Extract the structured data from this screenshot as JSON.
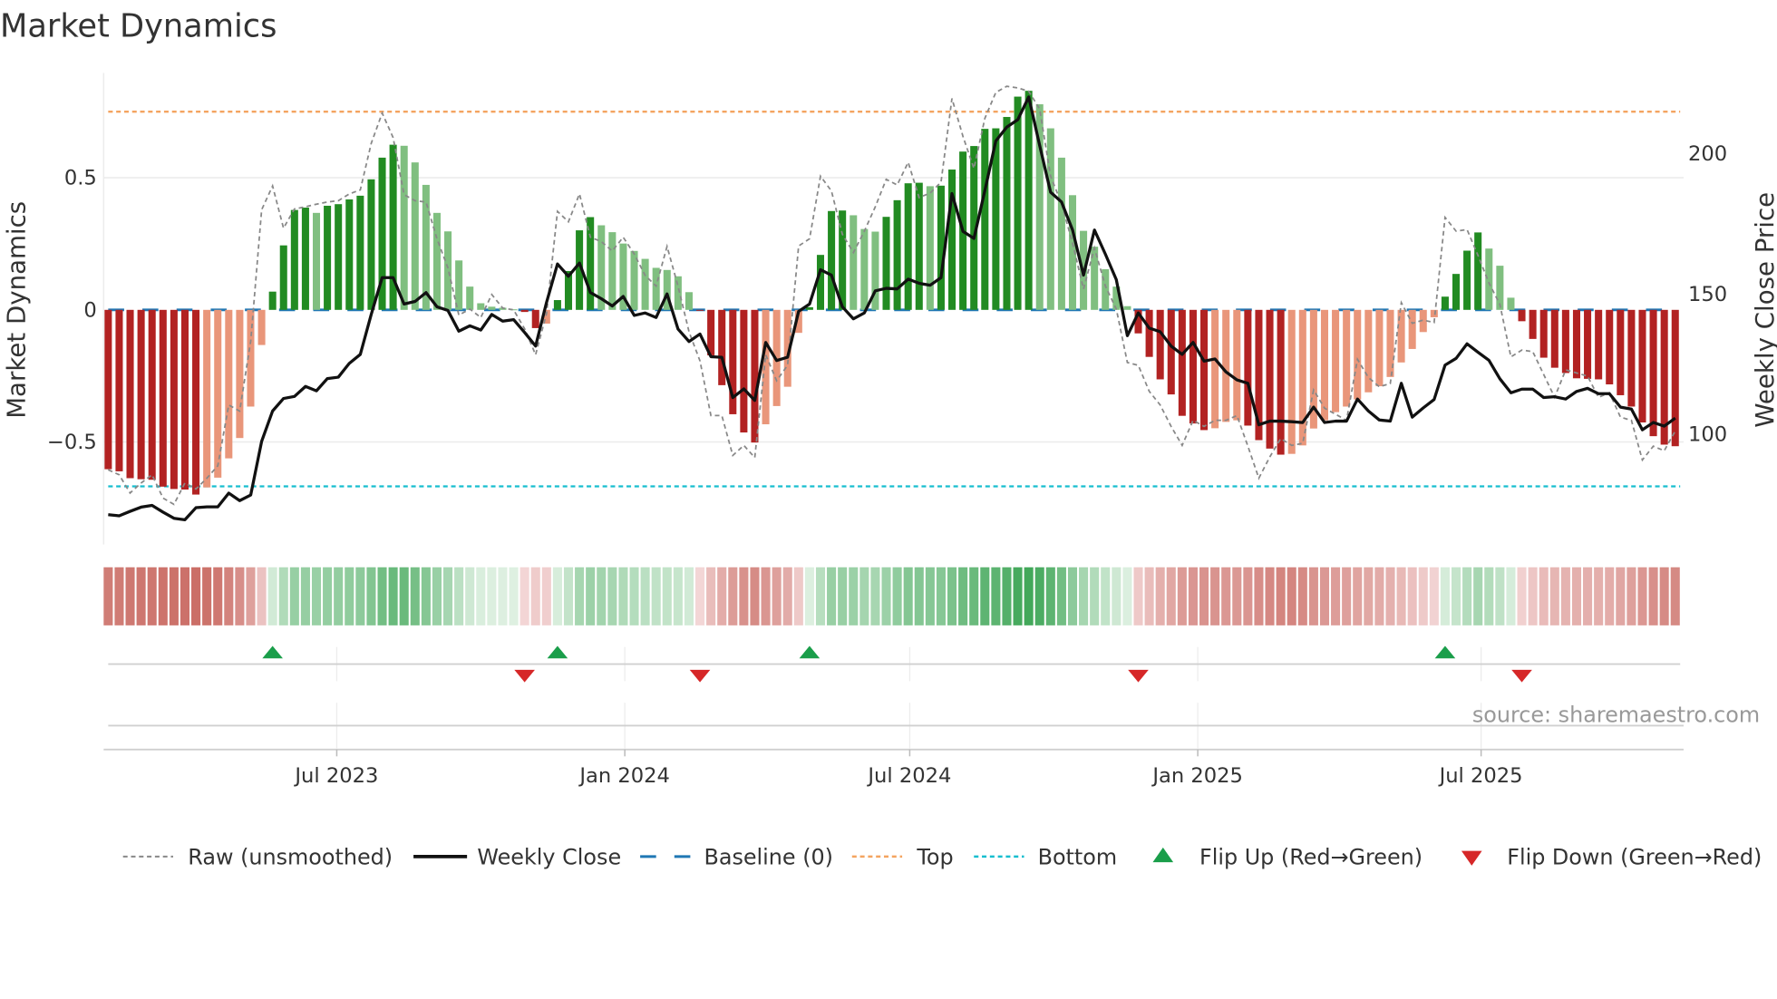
{
  "chart_data": {
    "type": "bar",
    "title": "Market Dynamics",
    "ylabel": "Market Dynamics",
    "ylabel_right": "Weekly Close Price",
    "ylim": [
      -0.8,
      0.85
    ],
    "ylim_right": [
      65,
      228
    ],
    "yticks": [
      {
        "value": 0.5,
        "label": "0.5"
      },
      {
        "value": 0,
        "label": "0"
      },
      {
        "value": -0.5,
        "label": "−0.5"
      }
    ],
    "yticks_right": [
      {
        "value": 200,
        "label": "200"
      },
      {
        "value": 150,
        "label": "150"
      },
      {
        "value": 100,
        "label": "100"
      }
    ],
    "xticks": [
      {
        "date": "2023-07-01",
        "label": "Jul 2023"
      },
      {
        "date": "2024-01-01",
        "label": "Jan 2024"
      },
      {
        "date": "2024-07-01",
        "label": "Jul 2024"
      },
      {
        "date": "2025-01-01",
        "label": "Jan 2025"
      },
      {
        "date": "2025-07-01",
        "label": "Jul 2025"
      }
    ],
    "start_date": "2023-02-05",
    "frequency": "weekly",
    "top_level": 0.75,
    "bottom_level": -0.668,
    "baseline": 0,
    "colors": {
      "up_strong": "#228b22",
      "up_weak": "#80bf80",
      "down_strong": "#b22222",
      "down_weak": "#e9967a",
      "close": "#111111",
      "raw": "#888888",
      "baseline": "#1f77b4",
      "top": "#f4a460",
      "bottom": "#17becf",
      "flip_up": "#1a9e4a",
      "flip_down": "#d62728"
    },
    "series": [
      {
        "name": "Market Dynamics",
        "values": [
          -0.603,
          -0.611,
          -0.637,
          -0.641,
          -0.643,
          -0.669,
          -0.678,
          -0.68,
          -0.699,
          -0.672,
          -0.635,
          -0.562,
          -0.485,
          -0.366,
          -0.133,
          0.069,
          0.244,
          0.378,
          0.387,
          0.367,
          0.394,
          0.4,
          0.418,
          0.432,
          0.494,
          0.576,
          0.625,
          0.621,
          0.558,
          0.473,
          0.367,
          0.297,
          0.187,
          0.088,
          0.025,
          0.012,
          0.008,
          0.002,
          -0.008,
          -0.069,
          -0.052,
          0.037,
          0.147,
          0.301,
          0.351,
          0.32,
          0.294,
          0.251,
          0.223,
          0.193,
          0.159,
          0.151,
          0.127,
          0.067,
          -0.003,
          -0.172,
          -0.285,
          -0.395,
          -0.464,
          -0.502,
          -0.433,
          -0.364,
          -0.291,
          -0.087,
          0.01,
          0.208,
          0.374,
          0.376,
          0.358,
          0.306,
          0.296,
          0.352,
          0.415,
          0.479,
          0.481,
          0.468,
          0.47,
          0.531,
          0.599,
          0.62,
          0.685,
          0.687,
          0.73,
          0.807,
          0.829,
          0.778,
          0.687,
          0.576,
          0.434,
          0.299,
          0.239,
          0.154,
          0.088,
          0.014,
          -0.089,
          -0.178,
          -0.263,
          -0.32,
          -0.401,
          -0.43,
          -0.455,
          -0.448,
          -0.424,
          -0.418,
          -0.438,
          -0.493,
          -0.525,
          -0.548,
          -0.545,
          -0.513,
          -0.449,
          -0.418,
          -0.387,
          -0.366,
          -0.339,
          -0.312,
          -0.289,
          -0.254,
          -0.199,
          -0.148,
          -0.084,
          -0.028,
          0.05,
          0.136,
          0.224,
          0.293,
          0.232,
          0.167,
          0.046,
          -0.043,
          -0.11,
          -0.181,
          -0.219,
          -0.239,
          -0.259,
          -0.261,
          -0.263,
          -0.282,
          -0.323,
          -0.366,
          -0.426,
          -0.478,
          -0.51,
          -0.516
        ]
      },
      {
        "name": "Raw (unsmoothed)",
        "values": [
          -0.605,
          -0.624,
          -0.693,
          -0.655,
          -0.624,
          -0.712,
          -0.736,
          -0.655,
          -0.678,
          -0.637,
          -0.59,
          -0.36,
          -0.383,
          -0.118,
          0.379,
          0.469,
          0.309,
          0.382,
          0.39,
          0.4,
          0.408,
          0.413,
          0.439,
          0.454,
          0.63,
          0.745,
          0.652,
          0.436,
          0.413,
          0.408,
          0.269,
          0.159,
          -0.02,
          0.003,
          -0.029,
          0.058,
          0.007,
          0.0,
          -0.072,
          -0.17,
          -0.014,
          0.373,
          0.333,
          0.439,
          0.275,
          0.258,
          0.223,
          0.275,
          0.211,
          0.13,
          0.09,
          0.24,
          0.09,
          -0.083,
          -0.193,
          -0.4,
          -0.4,
          -0.551,
          -0.513,
          -0.559,
          -0.17,
          -0.268,
          -0.21,
          0.242,
          0.269,
          0.506,
          0.45,
          0.286,
          0.217,
          0.298,
          0.39,
          0.494,
          0.473,
          0.558,
          0.425,
          0.442,
          0.483,
          0.8,
          0.656,
          0.535,
          0.725,
          0.823,
          0.846,
          0.84,
          0.827,
          0.76,
          0.506,
          0.402,
          0.252,
          0.079,
          0.234,
          0.09,
          0.003,
          -0.199,
          -0.21,
          -0.308,
          -0.36,
          -0.441,
          -0.513,
          -0.418,
          -0.441,
          -0.418,
          -0.418,
          -0.4,
          -0.516,
          -0.637,
          -0.557,
          -0.487,
          -0.513,
          -0.505,
          -0.303,
          -0.372,
          -0.395,
          -0.418,
          -0.187,
          -0.256,
          -0.291,
          -0.279,
          0.027,
          -0.051,
          -0.039,
          -0.048,
          0.35,
          0.298,
          0.304,
          0.206,
          0.102,
          0.021,
          -0.178,
          -0.152,
          -0.158,
          -0.245,
          -0.331,
          -0.227,
          -0.239,
          -0.251,
          -0.331,
          -0.314,
          -0.406,
          -0.418,
          -0.568,
          -0.516,
          -0.533,
          -0.458
        ]
      },
      {
        "name": "Weekly Close",
        "axis": "right",
        "values": [
          71.2,
          70.8,
          72.4,
          73.9,
          74.5,
          72.1,
          69.9,
          69.4,
          73.7,
          74.0,
          74.0,
          78.9,
          76.2,
          78.2,
          97.4,
          108.2,
          112.7,
          113.4,
          117.0,
          115.4,
          119.8,
          120.3,
          125.2,
          128.4,
          142.7,
          155.8,
          155.8,
          146.4,
          147.3,
          150.5,
          145.4,
          144.1,
          136.7,
          138.6,
          137.1,
          142.7,
          140.3,
          140.8,
          136.2,
          131.4,
          147.0,
          160.7,
          156.3,
          161.0,
          150.5,
          148.3,
          145.7,
          149.1,
          142.3,
          143.2,
          141.6,
          150.0,
          137.5,
          133.0,
          135.7,
          127.6,
          127.4,
          113.0,
          116.1,
          112.0,
          132.7,
          126.2,
          127.4,
          143.8,
          146.4,
          158.6,
          156.7,
          145.4,
          141.1,
          143.2,
          151.1,
          152.0,
          151.8,
          155.3,
          153.8,
          153.1,
          155.8,
          185.8,
          172.3,
          169.8,
          186.9,
          204.6,
          209.5,
          212.2,
          220.3,
          203.0,
          186.3,
          182.8,
          172.8,
          156.7,
          172.8,
          164.2,
          155.1,
          135.1,
          143.2,
          137.8,
          136.5,
          131.4,
          128.4,
          132.7,
          126.0,
          126.8,
          122.2,
          119.3,
          118.1,
          103.3,
          104.6,
          104.6,
          104.4,
          104.1,
          109.6,
          104.1,
          104.6,
          104.6,
          112.5,
          108.2,
          105.0,
          104.6,
          118.1,
          106.0,
          109.3,
          112.3,
          124.6,
          127.0,
          132.2,
          129.2,
          126.3,
          119.7,
          114.7,
          116.0,
          116.0,
          113.0,
          113.3,
          112.5,
          115.2,
          116.3,
          114.4,
          114.4,
          109.6,
          108.9,
          101.5,
          104.1,
          102.8,
          105.7
        ]
      }
    ],
    "legend": {
      "position": "bottom",
      "items": [
        {
          "key": "raw",
          "label": "Raw (unsmoothed)"
        },
        {
          "key": "close",
          "label": "Weekly Close"
        },
        {
          "key": "baseline",
          "label": "Baseline (0)"
        },
        {
          "key": "top",
          "label": "Top"
        },
        {
          "key": "bottom",
          "label": "Bottom"
        },
        {
          "key": "flip_up",
          "label": "Flip Up (Red→Green)"
        },
        {
          "key": "flip_down",
          "label": "Flip Down (Green→Red)"
        }
      ]
    },
    "source": "source: sharemaestro.com"
  }
}
